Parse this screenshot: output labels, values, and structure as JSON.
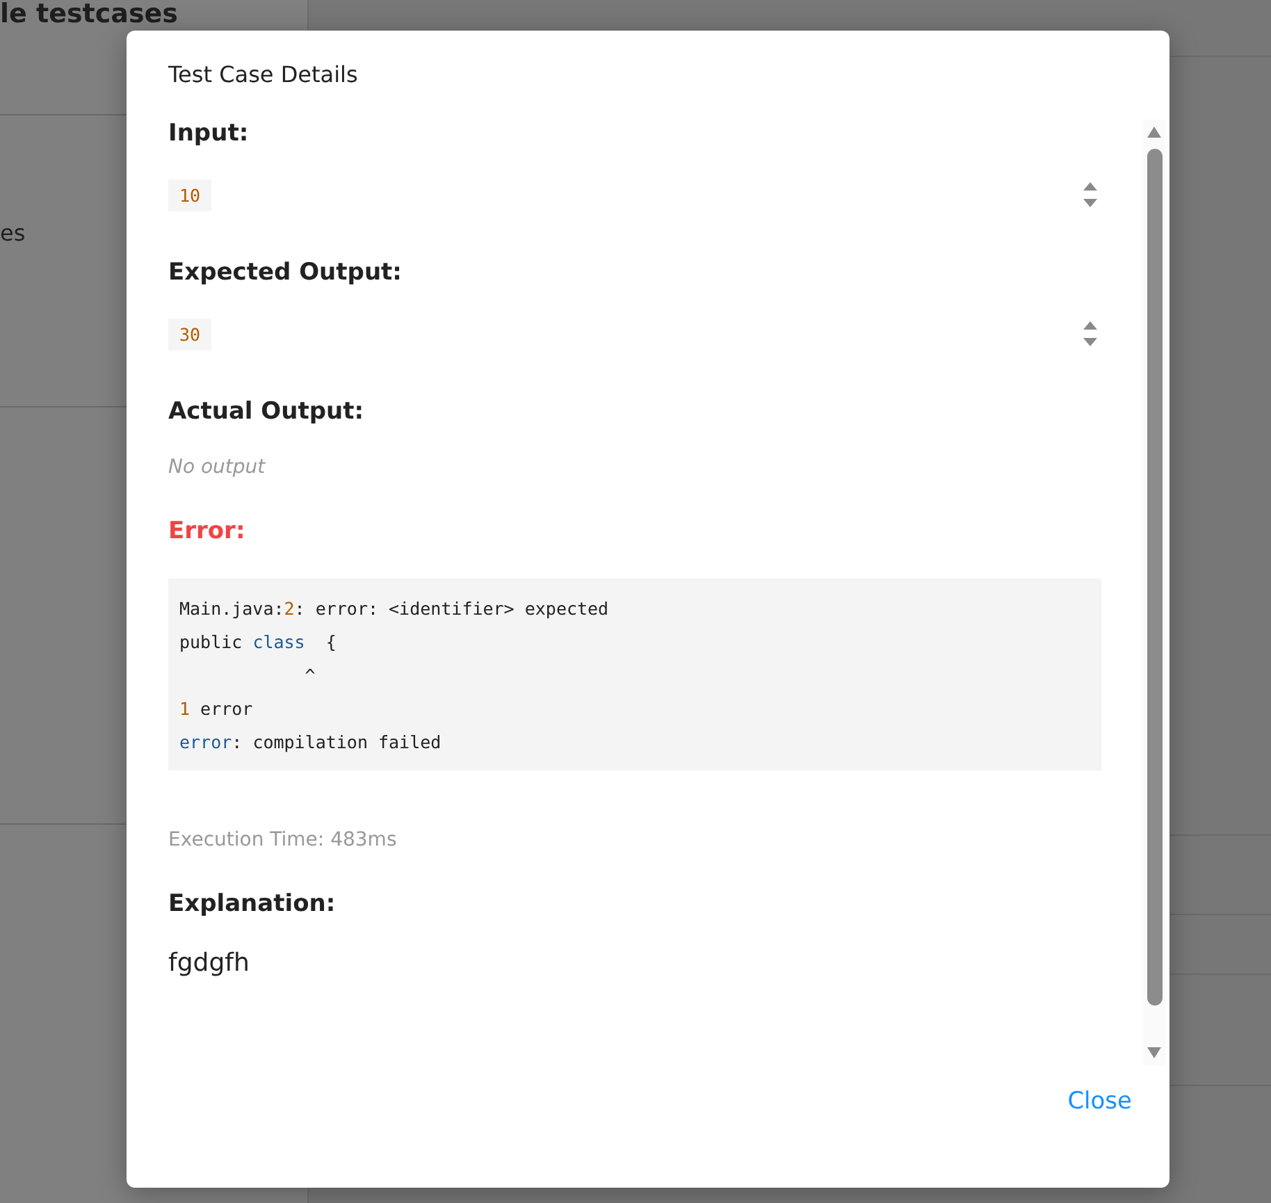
{
  "background_page": {
    "heading": "le testcases",
    "item_text": "es"
  },
  "dialog": {
    "title": "Test Case Details",
    "sections": [
      {
        "kind": "value",
        "heading": "Input:",
        "value": "10"
      },
      {
        "kind": "value",
        "heading": "Expected Output:",
        "value": "30"
      },
      {
        "kind": "empty",
        "heading": "Actual Output:",
        "note": "No output"
      },
      {
        "kind": "error",
        "heading": "Error:",
        "code_lines": [
          [
            {
              "text": "Main.java:",
              "kind": "plain"
            },
            {
              "text": "2",
              "kind": "number"
            },
            {
              "text": ": error: <identifier> expected",
              "kind": "plain"
            }
          ],
          [
            {
              "text": "public ",
              "kind": "plain"
            },
            {
              "text": "class",
              "kind": "keyword"
            },
            {
              "text": "  {",
              "kind": "plain"
            }
          ],
          [
            {
              "text": "            ^",
              "kind": "plain"
            }
          ],
          [
            {
              "text": "1",
              "kind": "number"
            },
            {
              "text": " error",
              "kind": "plain"
            }
          ],
          [
            {
              "text": "error",
              "kind": "keyword"
            },
            {
              "text": ": compilation failed",
              "kind": "plain"
            }
          ]
        ]
      },
      {
        "kind": "meta",
        "text": "Execution Time: 483ms"
      },
      {
        "kind": "text",
        "heading": "Explanation:",
        "body": "fgdgfh"
      }
    ],
    "close_button": "Close"
  }
}
